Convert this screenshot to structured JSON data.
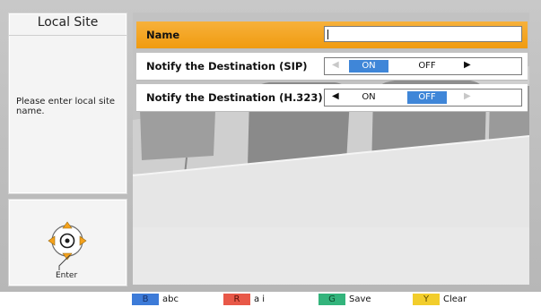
{
  "sidebar": {
    "title": "Local Site",
    "help_text": "Please enter local site name.",
    "enter_label": "Enter"
  },
  "form": {
    "name": {
      "label": "Name",
      "value": ""
    },
    "notify_sip": {
      "label": "Notify the Destination (SIP)",
      "on_label": "ON",
      "off_label": "OFF",
      "selected": "ON"
    },
    "notify_h323": {
      "label": "Notify the Destination (H.323)",
      "on_label": "ON",
      "off_label": "OFF",
      "selected": "OFF"
    }
  },
  "bottom_bar": {
    "blue": {
      "key": "B",
      "label": "abc",
      "color": "#3d7bd8"
    },
    "red": {
      "key": "R",
      "label": "a i",
      "color": "#e85848"
    },
    "green": {
      "key": "G",
      "label": "Save",
      "color": "#33b47c"
    },
    "yellow": {
      "key": "Y",
      "label": "Clear",
      "color": "#f2cd2c"
    }
  },
  "colors": {
    "selected_row": "#f09b10",
    "toggle_selected": "#3f86d8"
  }
}
